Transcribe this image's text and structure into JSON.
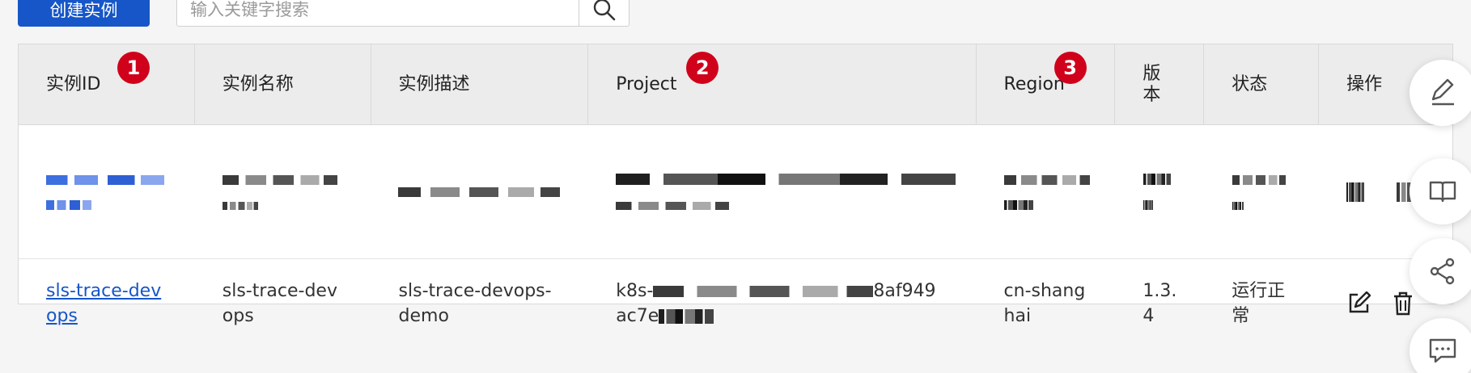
{
  "toolbar": {
    "create_label": "创建实例",
    "search_placeholder": "输入关键字搜索"
  },
  "table": {
    "headers": [
      "实例ID",
      "实例名称",
      "实例描述",
      "Project",
      "Region",
      "版本",
      "状态",
      "操作"
    ],
    "badges": [
      "1",
      "2",
      "3"
    ],
    "rows": [
      {
        "id": "sls-trace-devops",
        "name": "sls-trace-devops",
        "description": "sls-trace-devops-demo",
        "project_prefix": "k8s-",
        "project_suffix": "8af949",
        "project_line2": "ac7e",
        "region": "cn-shanghai",
        "version": "1.3.4",
        "status": "运行正常"
      }
    ]
  },
  "floating_actions": [
    "edit-icon",
    "guide-book-icon",
    "share-icon",
    "feedback-icon"
  ],
  "colors": {
    "primary": "#1656c8",
    "badge": "#d0021b"
  }
}
